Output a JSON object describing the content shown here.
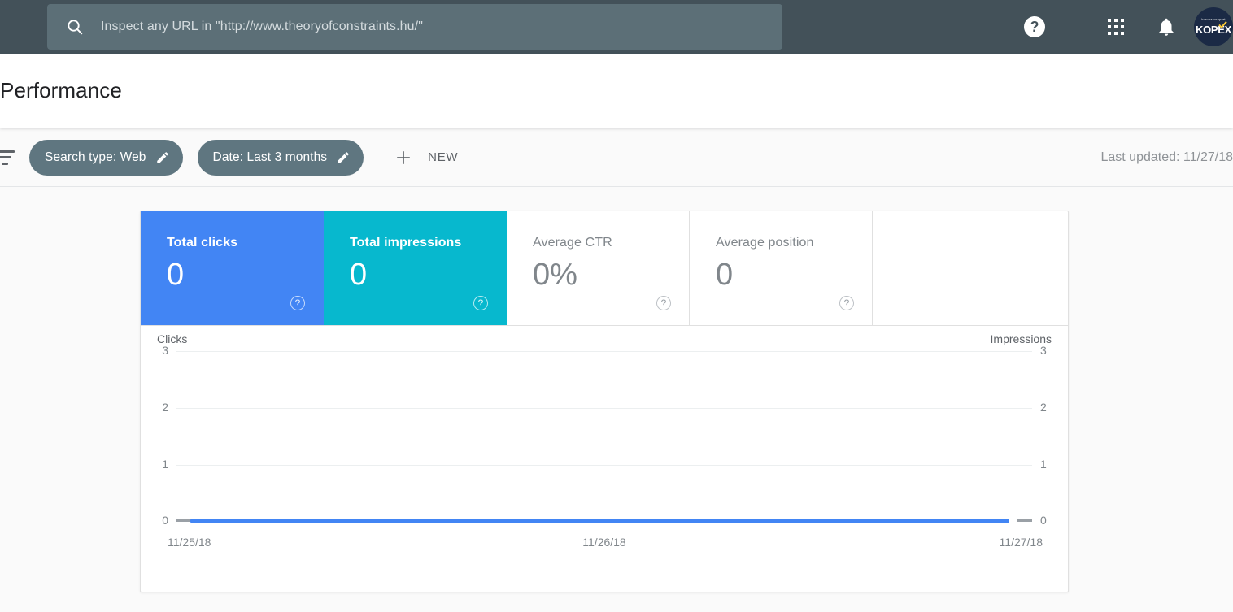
{
  "topbar": {
    "search": {
      "icon": "search-icon",
      "placeholder": "Inspect any URL in \"http://www.theoryofconstraints.hu/\"",
      "value": ""
    },
    "help_label": "?",
    "icons": [
      "help-icon",
      "apps-grid-icon",
      "notifications-bell-icon"
    ],
    "avatar": {
      "brand_top": "korona-csoport",
      "brand": "KOPEX"
    }
  },
  "header": {
    "title": "Performance"
  },
  "filterbar": {
    "filter_icon": "filter-icon",
    "chips": [
      {
        "label": "Search type: Web",
        "edit_icon": "pencil-icon"
      },
      {
        "label": "Date: Last 3 months",
        "edit_icon": "pencil-icon"
      }
    ],
    "new_button": {
      "icon": "plus-icon",
      "label": "NEW"
    },
    "last_updated": "Last updated: 11/27/18"
  },
  "metrics": [
    {
      "label": "Total clicks",
      "value": "0",
      "state": "active",
      "color": "#4285f4",
      "help": "?"
    },
    {
      "label": "Total impressions",
      "value": "0",
      "state": "active",
      "color": "#07b8ce",
      "help": "?"
    },
    {
      "label": "Average CTR",
      "value": "0%",
      "state": "inactive",
      "color": "#ffffff",
      "help": "?"
    },
    {
      "label": "Average position",
      "value": "0",
      "state": "inactive",
      "color": "#ffffff",
      "help": "?"
    }
  ],
  "chart_data": {
    "type": "line",
    "title": "",
    "left_axis_label": "Clicks",
    "right_axis_label": "Impressions",
    "x": [
      "11/25/18",
      "11/26/18",
      "11/27/18"
    ],
    "xlabel": "",
    "ylabel": "Clicks",
    "ylim": [
      0,
      3
    ],
    "y_ticks": [
      3,
      2,
      1,
      0
    ],
    "y2lim": [
      0,
      3
    ],
    "y2_ticks": [
      3,
      2,
      1,
      0
    ],
    "grid": true,
    "legend_position": "none",
    "series": [
      {
        "name": "Clicks",
        "values": [
          0,
          0,
          0
        ],
        "color": "#4285f4",
        "axis": "left"
      },
      {
        "name": "Impressions",
        "values": [
          0,
          0,
          0
        ],
        "color": "#07b8ce",
        "axis": "right",
        "visible": false
      }
    ]
  }
}
